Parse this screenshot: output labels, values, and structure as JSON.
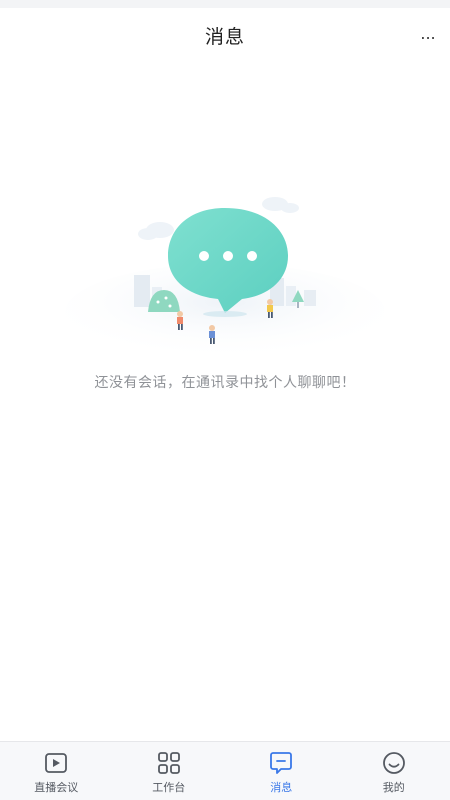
{
  "header": {
    "title": "消息",
    "more_label": "..."
  },
  "empty_state": {
    "message": "还没有会话，在通讯录中找个人聊聊吧！",
    "illustration_icon": "chat-bubble-illustration"
  },
  "tabbar": {
    "active_color": "#3a78e8",
    "inactive_color": "#555a62",
    "tabs": [
      {
        "label": "直播会议",
        "icon": "live-meeting-icon",
        "active": false
      },
      {
        "label": "工作台",
        "icon": "workbench-grid-icon",
        "active": false
      },
      {
        "label": "消息",
        "icon": "message-icon",
        "active": true
      },
      {
        "label": "我的",
        "icon": "profile-smile-icon",
        "active": false
      }
    ]
  }
}
